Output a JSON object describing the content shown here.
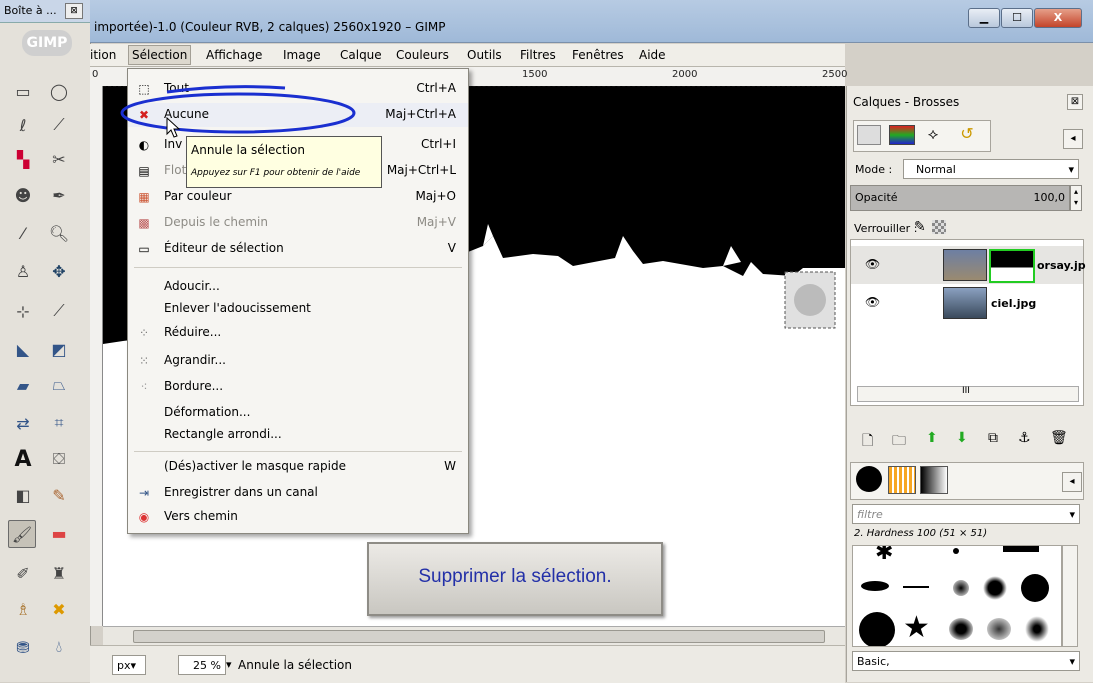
{
  "toolbox": {
    "title": "Boîte à ...",
    "close_glyph": "⊠",
    "logo": "GIMP"
  },
  "window": {
    "title": "importée)-1.0 (Couleur RVB, 2 calques) 2560x1920 – GIMP",
    "minimize": "▁",
    "maximize": "☐",
    "close": "X"
  },
  "menubar": [
    "ition",
    "Sélection",
    "Affichage",
    "Image",
    "Calque",
    "Couleurs",
    "Outils",
    "Filtres",
    "Fenêtres",
    "Aide"
  ],
  "ruler": {
    "ticks": [
      "0",
      "1500",
      "2000",
      "2500",
      "3000"
    ]
  },
  "selection_menu": {
    "items": [
      {
        "label": "Tout",
        "shortcut": "Ctrl+A",
        "icon": "select-all-icon",
        "glyph": "⬚",
        "disabled": false
      },
      {
        "label": "Aucune",
        "shortcut": "Maj+Ctrl+A",
        "icon": "select-none-icon",
        "glyph": "✖",
        "disabled": false
      },
      {
        "label": "Inv",
        "shortcut": "Ctrl+I",
        "icon": "invert-selection-icon",
        "glyph": "◐",
        "disabled": false
      },
      {
        "label": "Flot",
        "shortcut": "Maj+Ctrl+L",
        "icon": "float-icon",
        "glyph": "▤",
        "disabled": true
      },
      {
        "label": "Par couleur",
        "shortcut": "Maj+O",
        "icon": "by-color-icon",
        "glyph": "▦",
        "disabled": false
      },
      {
        "label": "Depuis le chemin",
        "shortcut": "Maj+V",
        "icon": "from-path-icon",
        "glyph": "▩",
        "disabled": true
      },
      {
        "label": "Éditeur de sélection",
        "shortcut": "V",
        "icon": "selection-editor-icon",
        "glyph": "▭",
        "disabled": false
      },
      {
        "label": "Adoucir...",
        "shortcut": "",
        "icon": "",
        "glyph": "",
        "disabled": false
      },
      {
        "label": "Enlever l'adoucissement",
        "shortcut": "",
        "icon": "",
        "glyph": "",
        "disabled": false
      },
      {
        "label": "Réduire...",
        "shortcut": "",
        "icon": "shrink-icon",
        "glyph": "⁘",
        "disabled": false
      },
      {
        "label": "Agrandir...",
        "shortcut": "",
        "icon": "grow-icon",
        "glyph": "⁙",
        "disabled": false
      },
      {
        "label": "Bordure...",
        "shortcut": "",
        "icon": "border-icon",
        "glyph": "⁖",
        "disabled": false
      },
      {
        "label": "Déformation...",
        "shortcut": "",
        "icon": "",
        "glyph": "",
        "disabled": false
      },
      {
        "label": "Rectangle arrondi...",
        "shortcut": "",
        "icon": "",
        "glyph": "",
        "disabled": false
      },
      {
        "label": "(Dés)activer le masque rapide",
        "shortcut": "W",
        "icon": "",
        "glyph": "",
        "disabled": false
      },
      {
        "label": "Enregistrer dans un canal",
        "shortcut": "",
        "icon": "save-to-channel-icon",
        "glyph": "⇥",
        "disabled": false
      },
      {
        "label": "Vers chemin",
        "shortcut": "",
        "icon": "to-path-icon",
        "glyph": "◉",
        "disabled": false
      }
    ]
  },
  "tooltip": {
    "title": "Annule la sélection",
    "hint": "Appuyez sur F1 pour obtenir de l'aide"
  },
  "annotation": {
    "text": "Supprimer la sélection."
  },
  "statusbar": {
    "unit": "px▾",
    "zoom": "25 %",
    "message": "Annule la sélection"
  },
  "layers_dock": {
    "title": "Calques - Brosses",
    "mode_label": "Mode :",
    "mode_value": "Normal",
    "opacity_label": "Opacité",
    "opacity_value": "100,0",
    "lock_label": "Verrouiller :",
    "layers": [
      {
        "name": "orsay.jp",
        "selected": true
      },
      {
        "name": "ciel.jpg",
        "selected": false
      }
    ],
    "scroll_mid": "III"
  },
  "brushes_dock": {
    "filter_placeholder": "filtre",
    "brush_name": "2. Hardness 100 (51 × 51)",
    "preset": "Basic,"
  },
  "colors": {
    "annotation_text": "#2330a8",
    "annotation_ellipse": "#1a2fd0",
    "aucune_icon": "#d42020"
  }
}
